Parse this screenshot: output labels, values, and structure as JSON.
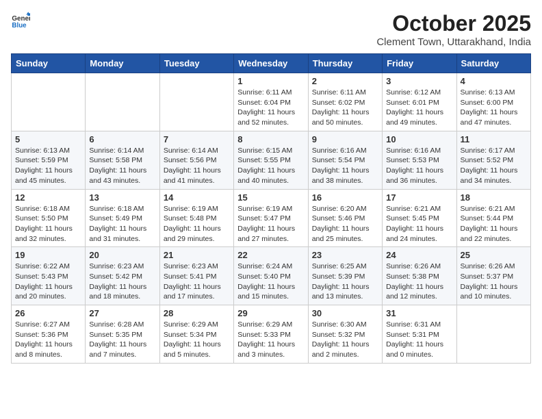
{
  "header": {
    "logo_general": "General",
    "logo_blue": "Blue",
    "month": "October 2025",
    "location": "Clement Town, Uttarakhand, India"
  },
  "weekdays": [
    "Sunday",
    "Monday",
    "Tuesday",
    "Wednesday",
    "Thursday",
    "Friday",
    "Saturday"
  ],
  "weeks": [
    [
      {
        "day": "",
        "info": ""
      },
      {
        "day": "",
        "info": ""
      },
      {
        "day": "",
        "info": ""
      },
      {
        "day": "1",
        "info": "Sunrise: 6:11 AM\nSunset: 6:04 PM\nDaylight: 11 hours\nand 52 minutes."
      },
      {
        "day": "2",
        "info": "Sunrise: 6:11 AM\nSunset: 6:02 PM\nDaylight: 11 hours\nand 50 minutes."
      },
      {
        "day": "3",
        "info": "Sunrise: 6:12 AM\nSunset: 6:01 PM\nDaylight: 11 hours\nand 49 minutes."
      },
      {
        "day": "4",
        "info": "Sunrise: 6:13 AM\nSunset: 6:00 PM\nDaylight: 11 hours\nand 47 minutes."
      }
    ],
    [
      {
        "day": "5",
        "info": "Sunrise: 6:13 AM\nSunset: 5:59 PM\nDaylight: 11 hours\nand 45 minutes."
      },
      {
        "day": "6",
        "info": "Sunrise: 6:14 AM\nSunset: 5:58 PM\nDaylight: 11 hours\nand 43 minutes."
      },
      {
        "day": "7",
        "info": "Sunrise: 6:14 AM\nSunset: 5:56 PM\nDaylight: 11 hours\nand 41 minutes."
      },
      {
        "day": "8",
        "info": "Sunrise: 6:15 AM\nSunset: 5:55 PM\nDaylight: 11 hours\nand 40 minutes."
      },
      {
        "day": "9",
        "info": "Sunrise: 6:16 AM\nSunset: 5:54 PM\nDaylight: 11 hours\nand 38 minutes."
      },
      {
        "day": "10",
        "info": "Sunrise: 6:16 AM\nSunset: 5:53 PM\nDaylight: 11 hours\nand 36 minutes."
      },
      {
        "day": "11",
        "info": "Sunrise: 6:17 AM\nSunset: 5:52 PM\nDaylight: 11 hours\nand 34 minutes."
      }
    ],
    [
      {
        "day": "12",
        "info": "Sunrise: 6:18 AM\nSunset: 5:50 PM\nDaylight: 11 hours\nand 32 minutes."
      },
      {
        "day": "13",
        "info": "Sunrise: 6:18 AM\nSunset: 5:49 PM\nDaylight: 11 hours\nand 31 minutes."
      },
      {
        "day": "14",
        "info": "Sunrise: 6:19 AM\nSunset: 5:48 PM\nDaylight: 11 hours\nand 29 minutes."
      },
      {
        "day": "15",
        "info": "Sunrise: 6:19 AM\nSunset: 5:47 PM\nDaylight: 11 hours\nand 27 minutes."
      },
      {
        "day": "16",
        "info": "Sunrise: 6:20 AM\nSunset: 5:46 PM\nDaylight: 11 hours\nand 25 minutes."
      },
      {
        "day": "17",
        "info": "Sunrise: 6:21 AM\nSunset: 5:45 PM\nDaylight: 11 hours\nand 24 minutes."
      },
      {
        "day": "18",
        "info": "Sunrise: 6:21 AM\nSunset: 5:44 PM\nDaylight: 11 hours\nand 22 minutes."
      }
    ],
    [
      {
        "day": "19",
        "info": "Sunrise: 6:22 AM\nSunset: 5:43 PM\nDaylight: 11 hours\nand 20 minutes."
      },
      {
        "day": "20",
        "info": "Sunrise: 6:23 AM\nSunset: 5:42 PM\nDaylight: 11 hours\nand 18 minutes."
      },
      {
        "day": "21",
        "info": "Sunrise: 6:23 AM\nSunset: 5:41 PM\nDaylight: 11 hours\nand 17 minutes."
      },
      {
        "day": "22",
        "info": "Sunrise: 6:24 AM\nSunset: 5:40 PM\nDaylight: 11 hours\nand 15 minutes."
      },
      {
        "day": "23",
        "info": "Sunrise: 6:25 AM\nSunset: 5:39 PM\nDaylight: 11 hours\nand 13 minutes."
      },
      {
        "day": "24",
        "info": "Sunrise: 6:26 AM\nSunset: 5:38 PM\nDaylight: 11 hours\nand 12 minutes."
      },
      {
        "day": "25",
        "info": "Sunrise: 6:26 AM\nSunset: 5:37 PM\nDaylight: 11 hours\nand 10 minutes."
      }
    ],
    [
      {
        "day": "26",
        "info": "Sunrise: 6:27 AM\nSunset: 5:36 PM\nDaylight: 11 hours\nand 8 minutes."
      },
      {
        "day": "27",
        "info": "Sunrise: 6:28 AM\nSunset: 5:35 PM\nDaylight: 11 hours\nand 7 minutes."
      },
      {
        "day": "28",
        "info": "Sunrise: 6:29 AM\nSunset: 5:34 PM\nDaylight: 11 hours\nand 5 minutes."
      },
      {
        "day": "29",
        "info": "Sunrise: 6:29 AM\nSunset: 5:33 PM\nDaylight: 11 hours\nand 3 minutes."
      },
      {
        "day": "30",
        "info": "Sunrise: 6:30 AM\nSunset: 5:32 PM\nDaylight: 11 hours\nand 2 minutes."
      },
      {
        "day": "31",
        "info": "Sunrise: 6:31 AM\nSunset: 5:31 PM\nDaylight: 11 hours\nand 0 minutes."
      },
      {
        "day": "",
        "info": ""
      }
    ]
  ]
}
